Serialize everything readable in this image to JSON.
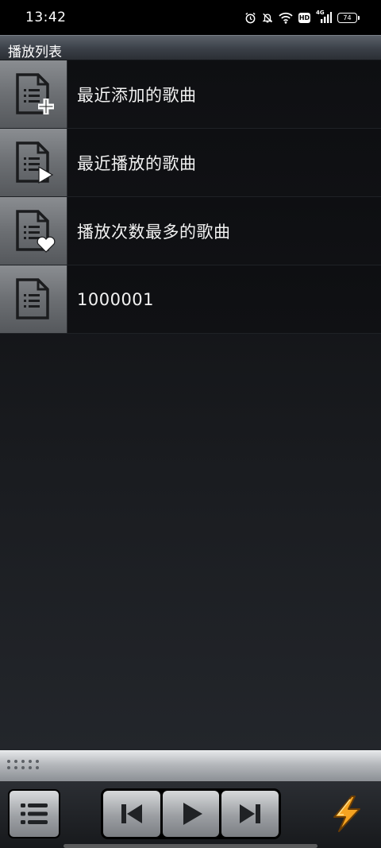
{
  "status_bar": {
    "time": "13:42",
    "network_label": "4G",
    "hd_label": "HD",
    "battery_level": "74",
    "icons": [
      "alarm-icon",
      "mute-icon",
      "wifi-icon",
      "hd-icon",
      "signal-icon",
      "battery-icon"
    ]
  },
  "title_bar": {
    "title": "播放列表"
  },
  "playlists": [
    {
      "label": "最近添加的歌曲",
      "icon": "playlist-add-icon"
    },
    {
      "label": "最近播放的歌曲",
      "icon": "playlist-play-icon"
    },
    {
      "label": "播放次数最多的歌曲",
      "icon": "playlist-heart-icon"
    },
    {
      "label": "1000001",
      "icon": "playlist-icon"
    }
  ],
  "controls": {
    "icons": [
      "list-icon",
      "previous-icon",
      "play-icon",
      "next-icon",
      "winamp-bolt-icon"
    ]
  },
  "colors": {
    "background": "#101114",
    "title_bar": "#3b4048",
    "button_silver": "#9ea1a5",
    "bolt_orange": "#f5a321"
  }
}
